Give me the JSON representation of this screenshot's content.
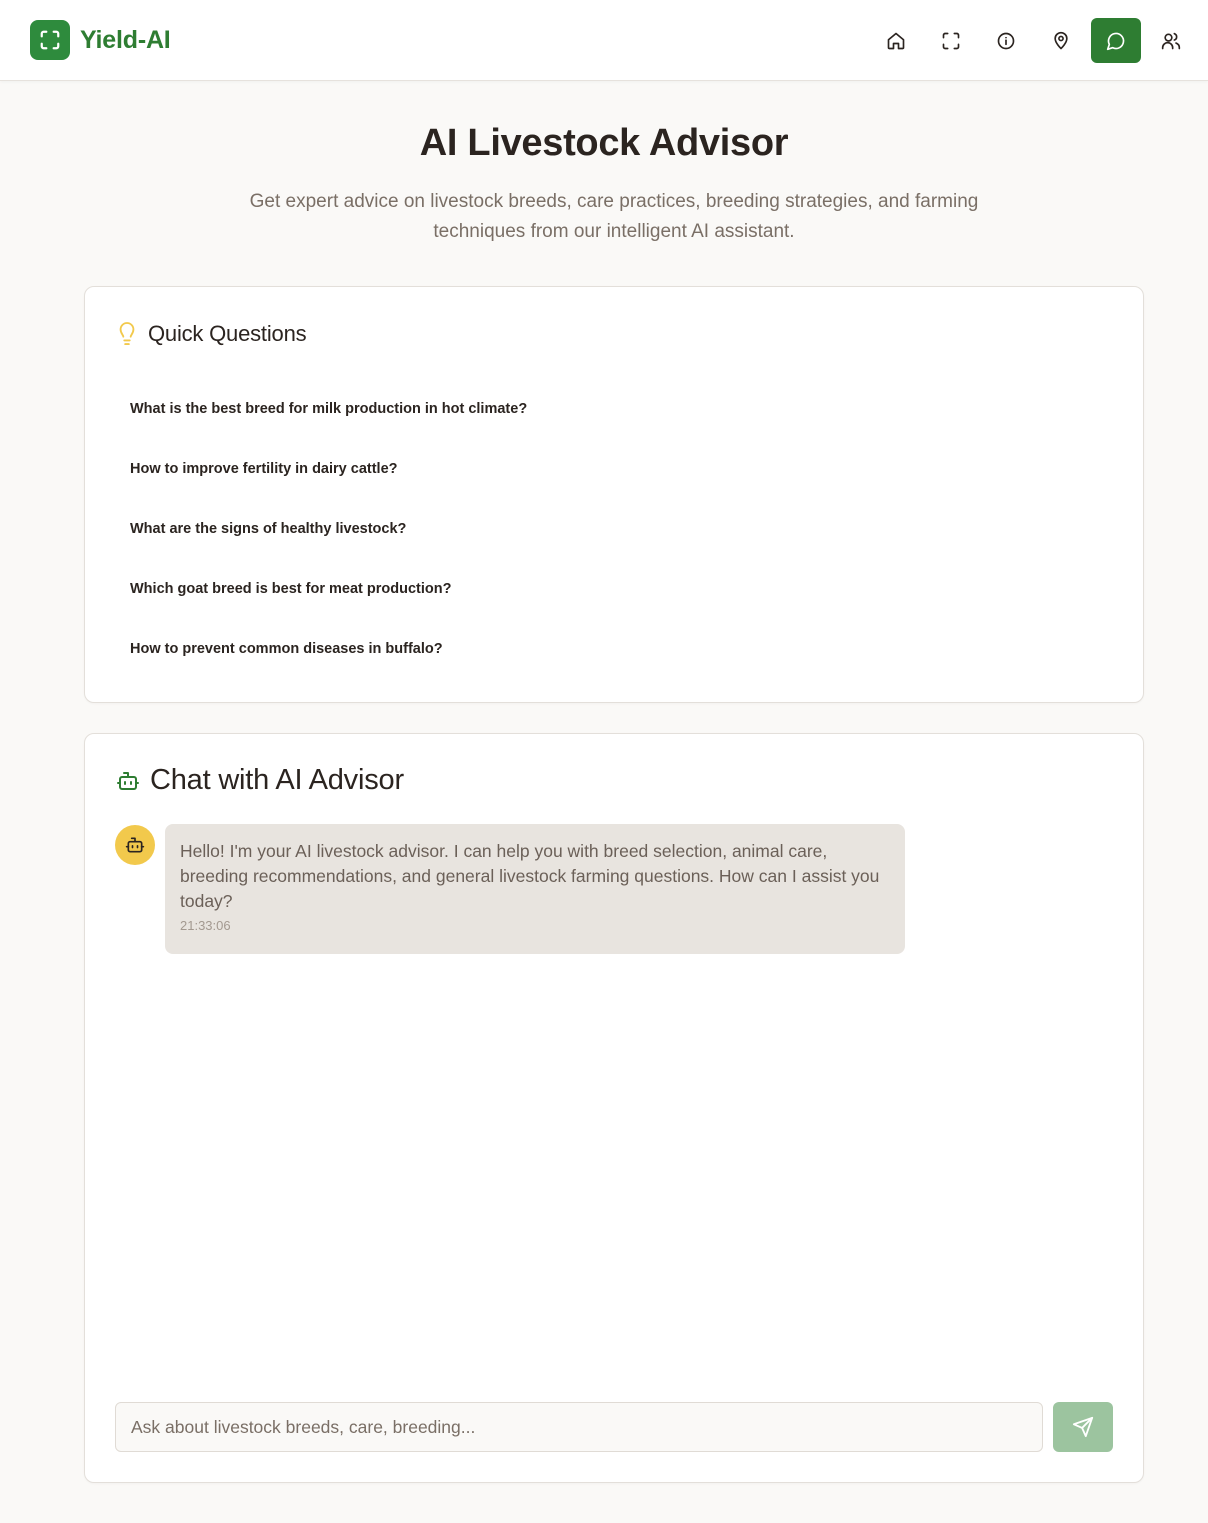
{
  "header": {
    "brand_name": "Yield-AI",
    "nav": [
      {
        "icon": "home-icon"
      },
      {
        "icon": "scan-icon"
      },
      {
        "icon": "info-icon"
      },
      {
        "icon": "map-pin-icon"
      },
      {
        "icon": "chat-icon",
        "active": true
      },
      {
        "icon": "users-icon"
      }
    ]
  },
  "hero": {
    "title": "AI Livestock Advisor",
    "subtitle": "Get expert advice on livestock breeds, care practices, breeding strategies, and farming techniques from our intelligent AI assistant."
  },
  "quick_questions": {
    "title": "Quick Questions",
    "items": [
      "What is the best breed for milk production in hot climate?",
      "How to improve fertility in dairy cattle?",
      "What are the signs of healthy livestock?",
      "Which goat breed is best for meat production?",
      "How to prevent common diseases in buffalo?"
    ]
  },
  "chat": {
    "title": "Chat with AI Advisor",
    "messages": [
      {
        "sender": "bot",
        "text": "Hello! I'm your AI livestock advisor. I can help you with breed selection, animal care, breeding recommendations, and general livestock farming questions. How can I assist you today?",
        "time": "21:33:06"
      }
    ],
    "input_placeholder": "Ask about livestock breeds, care, breeding...",
    "input_value": ""
  },
  "colors": {
    "brand": "#2e7d32",
    "accent_yellow": "#f2c94c",
    "send_disabled": "#9cc49f",
    "bubble_bg": "#e8e4df"
  }
}
